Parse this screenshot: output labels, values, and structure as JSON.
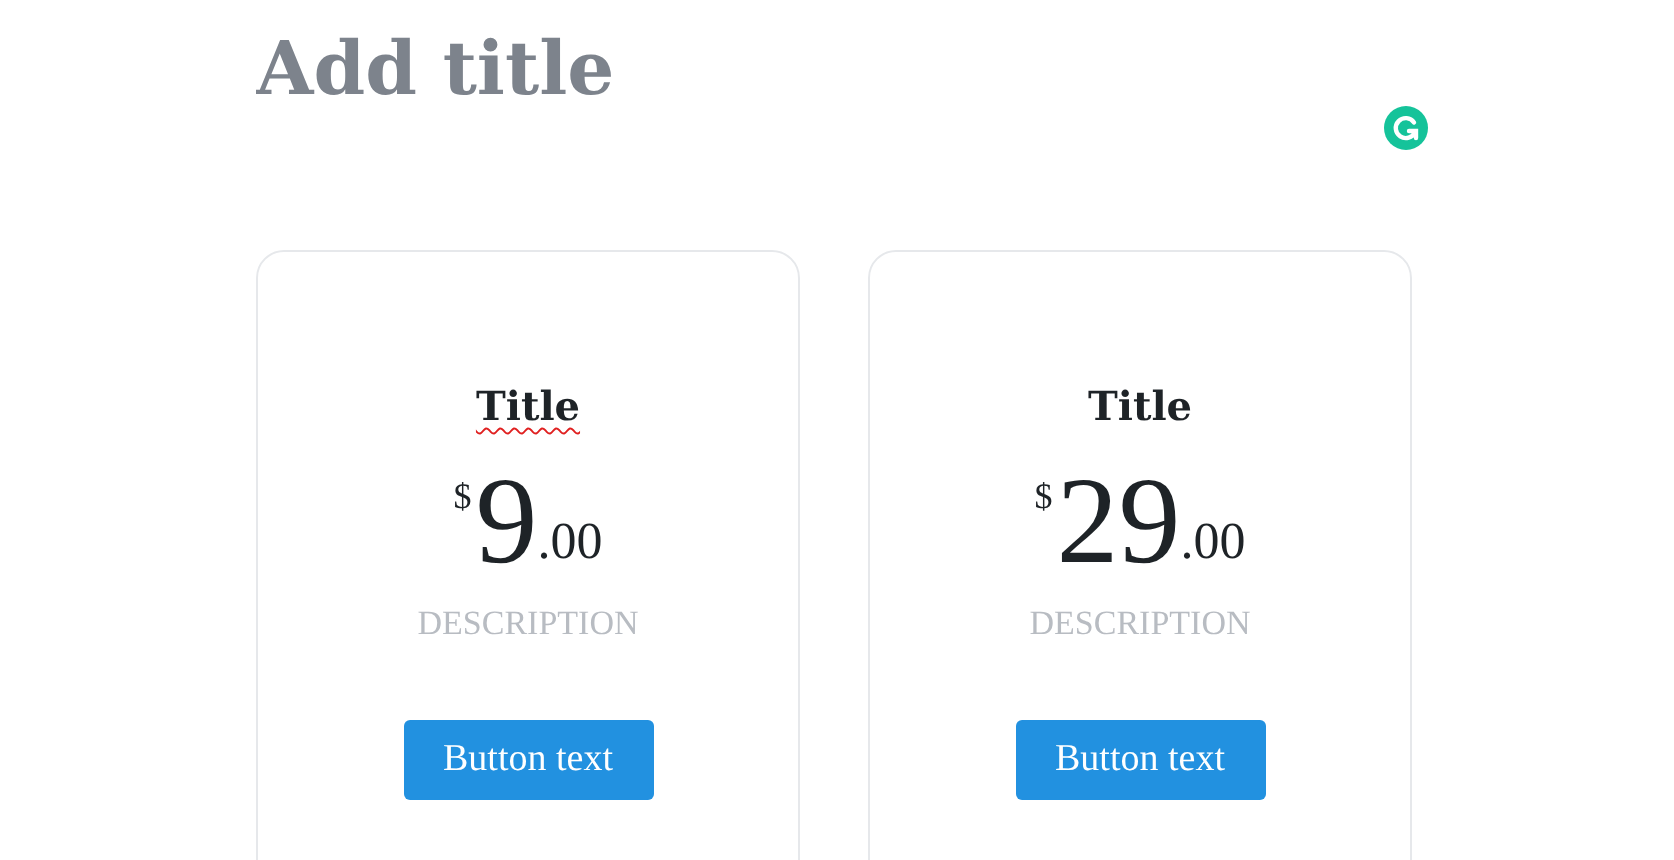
{
  "title": {
    "placeholder": "Add title"
  },
  "cards": [
    {
      "title": "Title",
      "misspelled": true,
      "currency": "$",
      "amount": "9",
      "cents": ".00",
      "description": "DESCRIPTION",
      "button": "Button text"
    },
    {
      "title": "Title",
      "misspelled": false,
      "currency": "$",
      "amount": "29",
      "cents": ".00",
      "description": "DESCRIPTION",
      "button": "Button text"
    }
  ]
}
